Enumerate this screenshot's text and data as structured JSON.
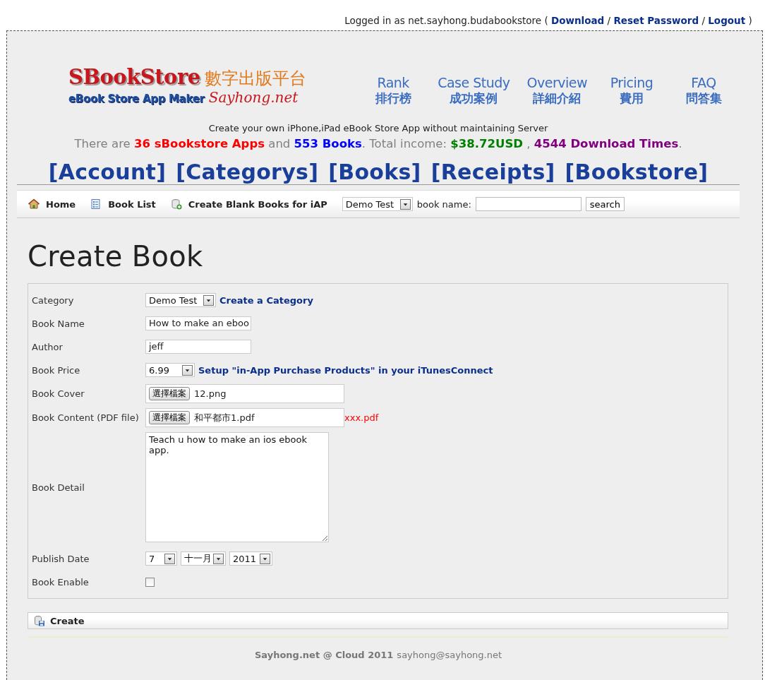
{
  "top_bar": {
    "logged_in": "Logged in as net.sayhong.budabookstore (",
    "links": [
      {
        "label": "Download",
        "sep": "/"
      },
      {
        "label": "Reset Password",
        "sep": "/"
      },
      {
        "label": "Logout",
        "sep": ")"
      }
    ]
  },
  "logo": {
    "title": "SBookStore",
    "subtitle_zh": "數字出版平台",
    "tagline": "eBook Store App Maker",
    "site": "Sayhong.net"
  },
  "site_nav": [
    {
      "label": "Rank",
      "label_zh": "排行榜"
    },
    {
      "label": "Case Study",
      "label_zh": "成功案例"
    },
    {
      "label": "Overview",
      "label_zh": "詳細介紹"
    },
    {
      "label": "Pricing",
      "label_zh": "費用"
    },
    {
      "label": "FAQ",
      "label_zh": "問答集"
    }
  ],
  "slogan": "Create your own iPhone,iPad eBook Store App without maintaining Server",
  "stats": [
    {
      "kind": "plain",
      "text": "There are "
    },
    {
      "kind": "highlight",
      "text": "36 sBookstore Apps",
      "color": "#ff0000"
    },
    {
      "kind": "plain",
      "text": " and "
    },
    {
      "kind": "highlight",
      "text": "553 Books",
      "color": "#0000ff"
    },
    {
      "kind": "plain",
      "text": ". Total income: "
    },
    {
      "kind": "highlight",
      "text": "$38.72USD",
      "color": "#008000"
    },
    {
      "kind": "plain",
      "text": " , "
    },
    {
      "kind": "highlight",
      "text": "4544 Download Times",
      "color": "#800080"
    },
    {
      "kind": "plain",
      "text": "."
    }
  ],
  "main_menu": [
    "[Account]",
    "[Categorys]",
    "[Books]",
    "[Receipts]",
    "[Bookstore]"
  ],
  "toolbar": {
    "items": [
      {
        "label": "Home"
      },
      {
        "label": "Book List"
      },
      {
        "label": "Create Blank Books for iAP"
      }
    ],
    "category": "Demo Test",
    "search_label": "book name:",
    "search_button": "search"
  },
  "heading": "Create Book",
  "form": {
    "rows": [
      {
        "kind": "select",
        "label": "Category",
        "value": "Demo Test",
        "link": "Create a Category"
      },
      {
        "kind": "text",
        "label": "Book Name",
        "value": "How to make an eboo"
      },
      {
        "kind": "text",
        "label": "Author",
        "value": "jeff"
      },
      {
        "kind": "select",
        "label": "Book Price",
        "value": "6.99",
        "link": "Setup \"in-App Purchase Products\" in your iTunesConnect"
      },
      {
        "kind": "file",
        "label": "Book Cover",
        "button": "選擇檔案",
        "value": "12.png"
      },
      {
        "kind": "file",
        "label": "Book Content (PDF file)",
        "button": "選擇檔案",
        "value": "和平都市1.pdf",
        "note": "xxx.pdf"
      },
      {
        "kind": "textarea",
        "label": "Book Detail",
        "value": "Teach u how to make an ios ebook app."
      },
      {
        "kind": "date",
        "label": "Publish Date",
        "values": [
          "7",
          "十一月",
          "2011"
        ]
      },
      {
        "kind": "checkbox",
        "label": "Book Enable",
        "checked": false
      }
    ]
  },
  "create_button": "Create",
  "footer": {
    "copyright": "Sayhong.net @ Cloud 2011",
    "email": "sayhong@sayhong.net"
  }
}
